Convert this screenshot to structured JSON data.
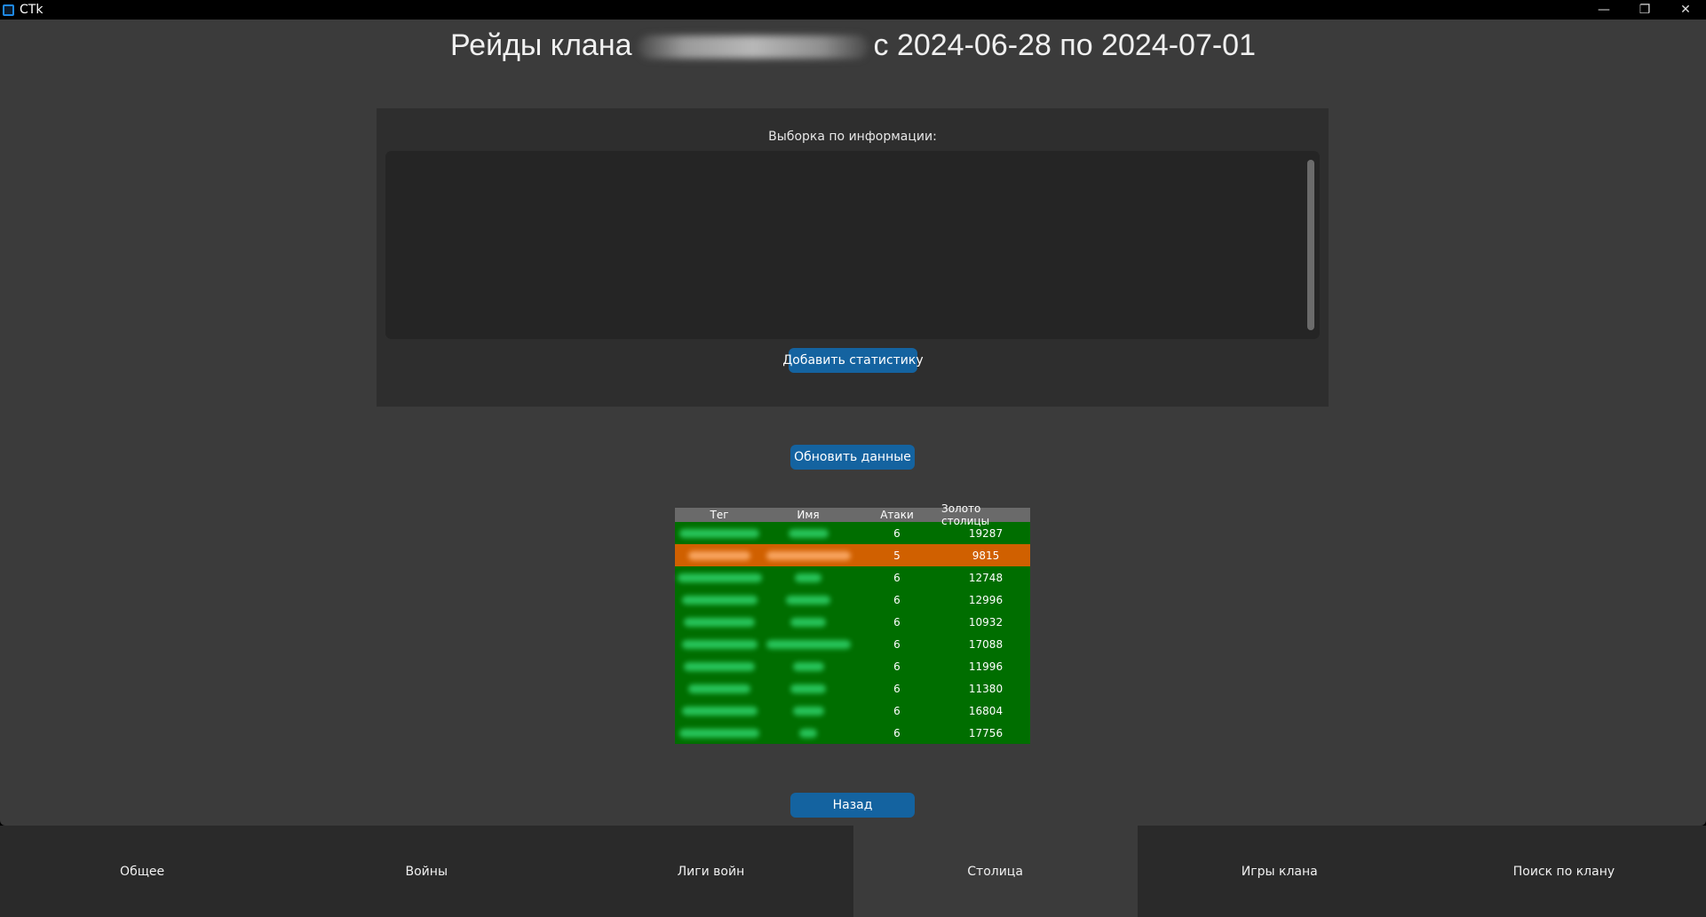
{
  "window": {
    "title": "CTk",
    "controls": [
      "—",
      "❐",
      "✕"
    ]
  },
  "page": {
    "title_prefix": "Рейды клана",
    "title_suffix": "с 2024-06-28 по 2024-07-01"
  },
  "filter_panel": {
    "label": "Выборка по информации:",
    "add_button": "Добавить статистику"
  },
  "refresh_button": "Обновить данные",
  "back_button": "Назад",
  "table": {
    "headers": [
      "Тег",
      "Имя",
      "Атаки",
      "Золото столицы"
    ],
    "colors": {
      "ok": "#006e00",
      "warn": "#d06000"
    },
    "rows": [
      {
        "attacks": "6",
        "gold": "19287",
        "status": "ok"
      },
      {
        "attacks": "5",
        "gold": "9815",
        "status": "warn"
      },
      {
        "attacks": "6",
        "gold": "12748",
        "status": "ok"
      },
      {
        "attacks": "6",
        "gold": "12996",
        "status": "ok"
      },
      {
        "attacks": "6",
        "gold": "10932",
        "status": "ok"
      },
      {
        "attacks": "6",
        "gold": "17088",
        "status": "ok"
      },
      {
        "attacks": "6",
        "gold": "11996",
        "status": "ok"
      },
      {
        "attacks": "6",
        "gold": "11380",
        "status": "ok"
      },
      {
        "attacks": "6",
        "gold": "16804",
        "status": "ok"
      },
      {
        "attacks": "6",
        "gold": "17756",
        "status": "ok"
      }
    ]
  },
  "nav": {
    "tabs": [
      "Общее",
      "Войны",
      "Лиги войн",
      "Столица",
      "Игры клана",
      "Поиск по клану"
    ],
    "active": "Столица"
  }
}
